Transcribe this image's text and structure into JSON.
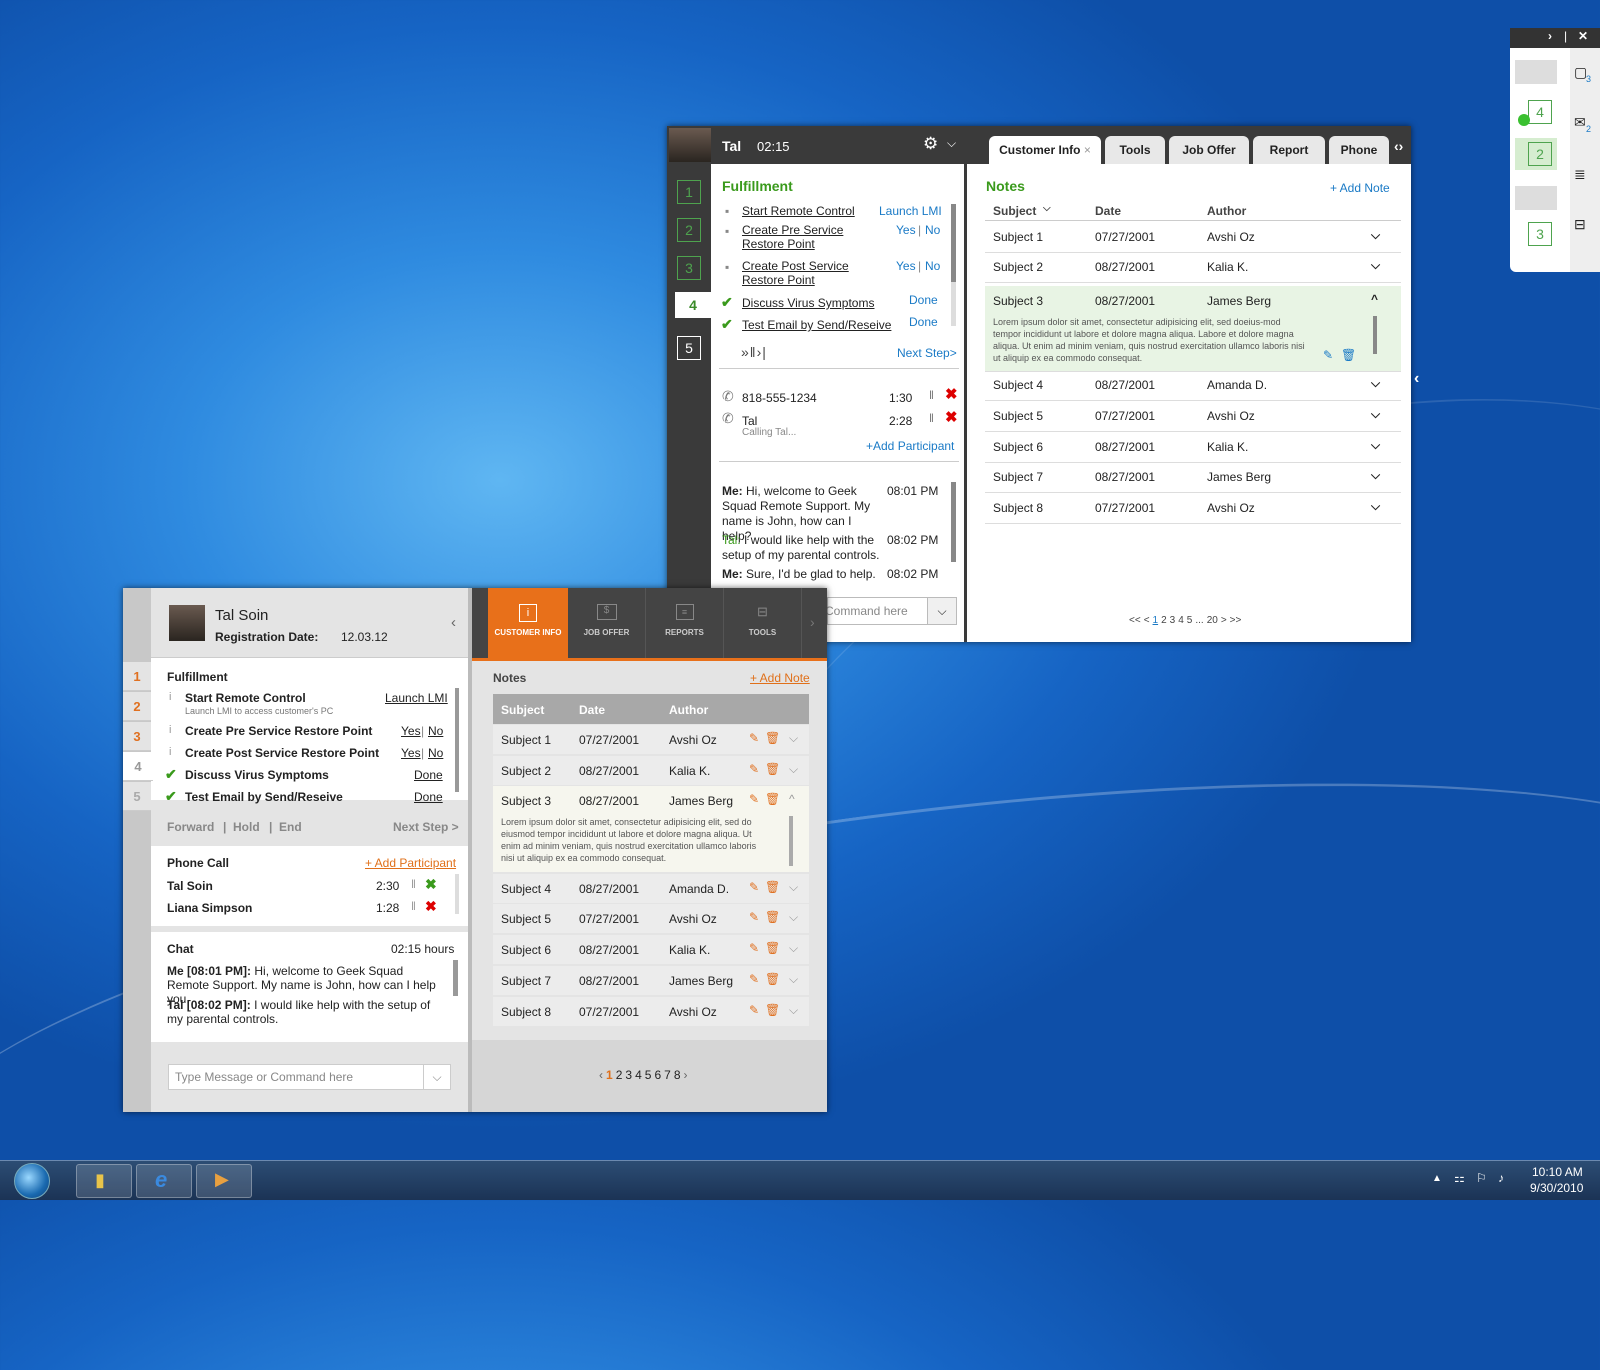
{
  "back_window": {
    "agent_name": "Tal",
    "timer": "02:15",
    "steps": [
      "1",
      "2",
      "3",
      "4",
      "5"
    ],
    "section_title": "Fulfillment",
    "tasks": [
      {
        "label": "Start Remote Control",
        "action": "Launch LMI"
      },
      {
        "label": "Create Pre Service Restore Point",
        "yes": "Yes",
        "no": "No"
      },
      {
        "label": "Create Post Service Restore Point",
        "yes": "Yes",
        "no": "No"
      },
      {
        "label": "Discuss Virus Symptoms",
        "action": "Done"
      },
      {
        "label": "Test Email by Send/Reseive",
        "action": "Done"
      }
    ],
    "next_step": "Next Step>",
    "calls": [
      {
        "name": "818-555-1234",
        "time": "1:30"
      },
      {
        "name": "Tal",
        "sub": "Calling Tal...",
        "time": "2:28"
      }
    ],
    "add_participant": "+Add Participant",
    "chat": [
      {
        "who": "Me:",
        "text": "Hi, welcome to Geek Squad Remote Support. My name is John, how can I help?",
        "time": "08:01 PM"
      },
      {
        "who": "Tal:",
        "text": "I would like help with the setup of my parental controls.",
        "time": "08:02 PM"
      },
      {
        "who": "Me:",
        "text": "Sure, I'd be glad to help.",
        "time": "08:02 PM"
      }
    ],
    "command_placeholder": "Command here",
    "tabs": [
      "Customer Info",
      "Tools",
      "Job Offer",
      "Report",
      "Phone"
    ],
    "notes_title": "Notes",
    "add_note": "+ Add Note",
    "columns": [
      "Subject",
      "Date",
      "Author"
    ],
    "notes": [
      {
        "subject": "Subject 1",
        "date": "07/27/2001",
        "author": "Avshi Oz"
      },
      {
        "subject": "Subject 2",
        "date": "08/27/2001",
        "author": "Kalia K."
      },
      {
        "subject": "Subject 3",
        "date": "08/27/2001",
        "author": "James Berg"
      },
      {
        "subject": "Subject 4",
        "date": "08/27/2001",
        "author": "Amanda D."
      },
      {
        "subject": "Subject 5",
        "date": "07/27/2001",
        "author": "Avshi Oz"
      },
      {
        "subject": "Subject 6",
        "date": "08/27/2001",
        "author": "Kalia K."
      },
      {
        "subject": "Subject 7",
        "date": "08/27/2001",
        "author": "James Berg"
      },
      {
        "subject": "Subject 8",
        "date": "07/27/2001",
        "author": "Avshi Oz"
      }
    ],
    "expanded_text": "Lorem ipsum dolor sit amet, consectetur adipisicing elit, sed doeius-mod tempor incididunt ut labore et dolore magna aliqua. Labore et dolore magna aliqua. Ut enim ad minim veniam, quis nostrud exercitation ullamco  laboris nisi ut aliquip ex ea commodo consequat.",
    "pagination": [
      "<<",
      "<",
      "1",
      "2",
      "3",
      "4",
      "5",
      "...",
      "20",
      ">",
      ">>"
    ]
  },
  "front_window": {
    "customer_name": "Tal Soin",
    "reg_label": "Registration Date:",
    "reg_date": "12.03.12",
    "steps": [
      "1",
      "2",
      "3",
      "4",
      "5"
    ],
    "section_title": "Fulfillment",
    "tasks": [
      {
        "label": "Start Remote Control",
        "sub": "Launch LMI to access customer's PC",
        "action": "Launch LMI"
      },
      {
        "label": "Create Pre Service Restore Point",
        "yes": "Yes",
        "no": "No"
      },
      {
        "label": "Create Post Service Restore Point",
        "yes": "Yes",
        "no": "No"
      },
      {
        "label": "Discuss Virus Symptoms",
        "action": "Done"
      },
      {
        "label": "Test Email by Send/Reseive",
        "action": "Done"
      }
    ],
    "controls": [
      "Forward",
      "Hold",
      "End"
    ],
    "next_step": "Next Step >",
    "phone_title": "Phone Call",
    "add_participant": "+ Add Participant",
    "calls": [
      {
        "name": "Tal Soin",
        "time": "2:30"
      },
      {
        "name": "Liana Simpson",
        "time": "1:28"
      }
    ],
    "chat_title": "Chat",
    "chat_time": "02:15 hours",
    "chat": [
      {
        "who": "Me [08:01 PM]:",
        "text": "Hi, welcome to Geek Squad Remote Support. My name is John, how can I help you."
      },
      {
        "who": "Tal [08:02 PM]:",
        "text": "I would like help with the setup of my parental controls."
      }
    ],
    "message_placeholder": "Type Message or Command here",
    "nav": [
      "CUSTOMER INFO",
      "JOB OFFER",
      "REPORTS",
      "TOOLS"
    ],
    "notes_title": "Notes",
    "add_note": "+ Add Note",
    "columns": [
      "Subject",
      "Date",
      "Author"
    ],
    "notes": [
      {
        "subject": "Subject 1",
        "date": "07/27/2001",
        "author": "Avshi Oz"
      },
      {
        "subject": "Subject 2",
        "date": "08/27/2001",
        "author": "Kalia K."
      },
      {
        "subject": "Subject 3",
        "date": "08/27/2001",
        "author": "James Berg"
      },
      {
        "subject": "Subject 4",
        "date": "08/27/2001",
        "author": "Amanda D."
      },
      {
        "subject": "Subject 5",
        "date": "07/27/2001",
        "author": "Avshi Oz"
      },
      {
        "subject": "Subject 6",
        "date": "08/27/2001",
        "author": "Kalia K."
      },
      {
        "subject": "Subject 7",
        "date": "08/27/2001",
        "author": "James Berg"
      },
      {
        "subject": "Subject 8",
        "date": "07/27/2001",
        "author": "Avshi Oz"
      }
    ],
    "expanded_text": "Lorem ipsum dolor sit amet, consectetur adipisicing elit, sed do eiusmod tempor incididunt ut labore et dolore magna aliqua. Ut enim ad minim veniam, quis nostrud exercitation ullamco laboris nisi ut aliquip ex ea commodo consequat.",
    "pages": [
      "1",
      "2",
      "3",
      "4",
      "5",
      "6",
      "7",
      "8"
    ]
  },
  "sidebar": {
    "badges": [
      "3",
      "4",
      "2",
      "2",
      "3"
    ]
  },
  "taskbar": {
    "time": "10:10 AM",
    "date": "9/30/2010"
  },
  "colors": {
    "accent_orange": "#e0701a",
    "accent_green": "#3a9a1c",
    "link_blue": "#1a7ac6"
  }
}
